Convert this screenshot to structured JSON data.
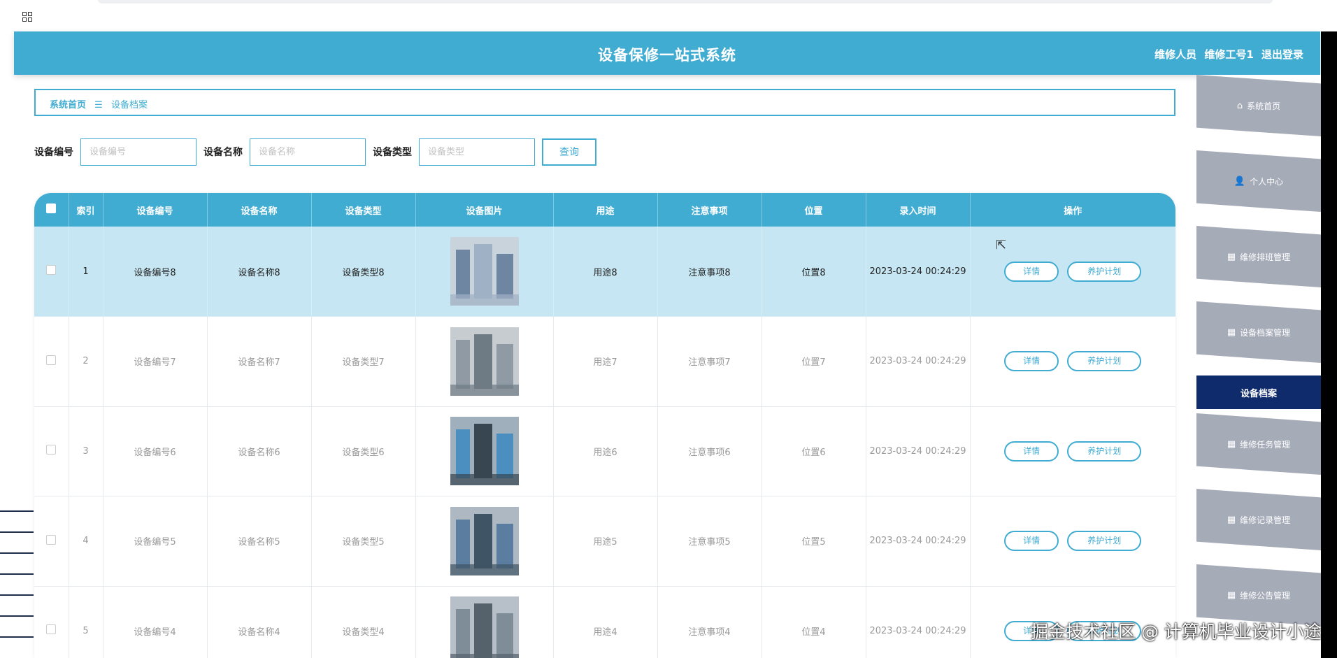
{
  "app": {
    "title": "设备保修一站式系统",
    "user_role": "维修人员",
    "user_id": "维修工号1",
    "logout": "退出登录"
  },
  "breadcrumb": {
    "home": "系统首页",
    "separator": "☰",
    "current": "设备档案"
  },
  "search": {
    "fields": [
      {
        "label": "设备编号",
        "placeholder": "设备编号",
        "value": ""
      },
      {
        "label": "设备名称",
        "placeholder": "设备名称",
        "value": ""
      },
      {
        "label": "设备类型",
        "placeholder": "设备类型",
        "value": ""
      }
    ],
    "button": "查询"
  },
  "table": {
    "columns": [
      "索引",
      "设备编号",
      "设备名称",
      "设备类型",
      "设备图片",
      "用途",
      "注意事项",
      "位置",
      "录入时间",
      "操作"
    ],
    "rows": [
      {
        "index": "1",
        "code": "设备编号8",
        "name": "设备名称8",
        "type": "设备类型8",
        "usage": "用途8",
        "notes": "注意事项8",
        "location": "位置8",
        "time": "2023-03-24 00:24:29",
        "active": true
      },
      {
        "index": "2",
        "code": "设备编号7",
        "name": "设备名称7",
        "type": "设备类型7",
        "usage": "用途7",
        "notes": "注意事项7",
        "location": "位置7",
        "time": "2023-03-24 00:24:29",
        "active": false
      },
      {
        "index": "3",
        "code": "设备编号6",
        "name": "设备名称6",
        "type": "设备类型6",
        "usage": "用途6",
        "notes": "注意事项6",
        "location": "位置6",
        "time": "2023-03-24 00:24:29",
        "active": false
      },
      {
        "index": "4",
        "code": "设备编号5",
        "name": "设备名称5",
        "type": "设备类型5",
        "usage": "用途5",
        "notes": "注意事项5",
        "location": "位置5",
        "time": "2023-03-24 00:24:29",
        "active": false
      },
      {
        "index": "5",
        "code": "设备编号4",
        "name": "设备名称4",
        "type": "设备类型4",
        "usage": "用途4",
        "notes": "注意事项4",
        "location": "位置4",
        "time": "2023-03-24 00:24:29",
        "active": false
      }
    ],
    "actions": {
      "detail": "详情",
      "plan": "养护计划"
    }
  },
  "sidebar": {
    "items": [
      {
        "label": "系统首页",
        "icon": "home-icon"
      },
      {
        "label": "个人中心",
        "icon": "user-icon"
      },
      {
        "label": "维修排班管理",
        "icon": "grid-icon"
      },
      {
        "label": "设备档案管理",
        "icon": "grid-icon"
      },
      {
        "label": "设备档案",
        "icon": "",
        "sub": true
      },
      {
        "label": "维修任务管理",
        "icon": "grid-icon"
      },
      {
        "label": "维修记录管理",
        "icon": "grid-icon"
      },
      {
        "label": "维修公告管理",
        "icon": "grid-icon"
      }
    ]
  },
  "watermark": "掘金技术社区 @ 计算机毕业设计小途",
  "colors": {
    "accent": "#41acd2",
    "sidebar_bg": "#a6abb8",
    "sidebar_active": "#0f2b6b",
    "row_active": "#c5e6f2"
  }
}
